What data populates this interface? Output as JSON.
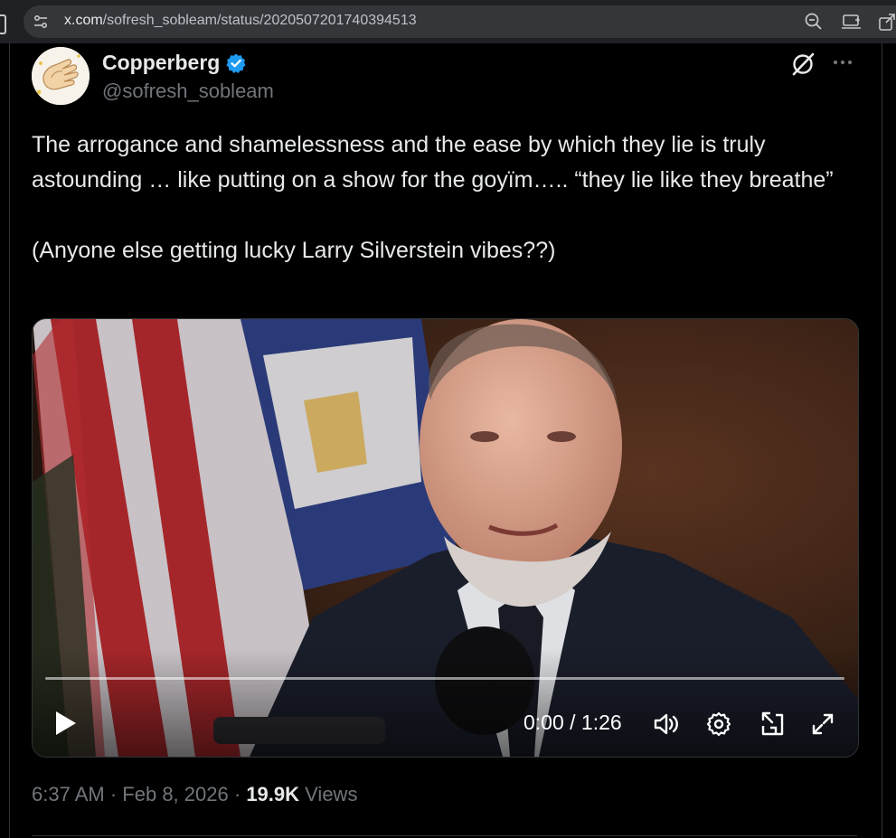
{
  "browser": {
    "url_host": "x.com",
    "url_path": "/sofresh_sobleam/status/2020507201740394513"
  },
  "tweet": {
    "author": {
      "display_name": "Copperberg",
      "handle": "@sofresh_sobleam",
      "verified": true
    },
    "text": "The arrogance and shamelessness and the ease by which they lie is truly astounding … like putting on a show for the goyïm….. “they lie like they breathe”\n\n(Anyone else getting lucky Larry Silverstein vibes??)",
    "video": {
      "time_display": "0:00 / 1:26",
      "progress": 0
    },
    "time": "6:37 AM",
    "date": "Feb 8, 2026",
    "separator": "·",
    "views_count": "19.9K",
    "views_label": "Views"
  },
  "colors": {
    "accent_verified": "#1d9bf0",
    "text_primary": "#e7e9ea",
    "text_secondary": "#71767b",
    "border": "#2f3336"
  }
}
